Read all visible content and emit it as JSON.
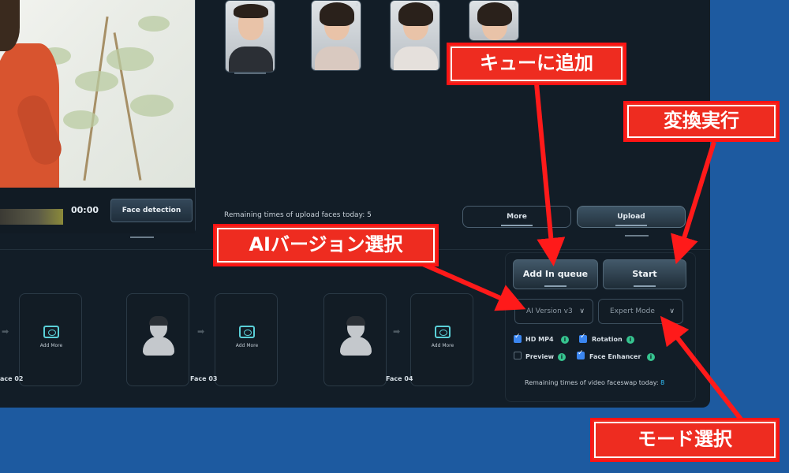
{
  "video": {
    "time": "00:00",
    "face_detection_label": "Face detection"
  },
  "faces_panel": {
    "remaining_text": "Remaining times of upload faces today: 5",
    "more_label": "More",
    "upload_label": "Upload",
    "close_glyph": "x"
  },
  "slots": {
    "add_more": "Add More",
    "labels": [
      "ace 02",
      "Face 03",
      "Face 04"
    ]
  },
  "actions": {
    "add_queue_label": "Add In queue",
    "start_label": "Start",
    "ai_version": "AI Version v3",
    "expert_mode": "Expert Mode",
    "chevron": "∨",
    "options": [
      {
        "label": "HD MP4",
        "checked": true
      },
      {
        "label": "Rotation",
        "checked": true
      },
      {
        "label": "Preview",
        "checked": false
      },
      {
        "label": "Face Enhancer",
        "checked": true
      }
    ],
    "info_glyph": "i",
    "video_remaining_text": "Remaining times of video faceswap today: ",
    "video_remaining_count": "8"
  },
  "annotations": {
    "add_queue": "キューに追加",
    "start": "変換実行",
    "ai_version": "AIバージョン選択",
    "mode": "モード選択"
  },
  "colors": {
    "annotation": "#ee2c20",
    "accent": "#3b86f0",
    "info": "#36c48f"
  }
}
